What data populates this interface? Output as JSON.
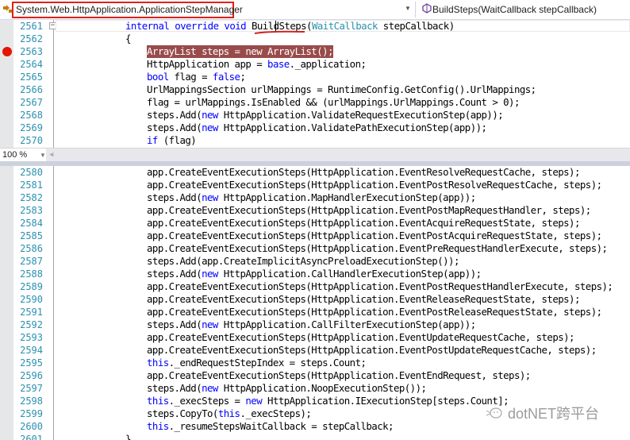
{
  "navbar": {
    "class_icon": "class-icon",
    "class_name": "System.Web.HttpApplication.ApplicationStepManager",
    "method_icon": "method-icon",
    "method_name": "BuildSteps(WaitCallback stepCallback)"
  },
  "editor": {
    "zoom_level": "100 %",
    "breakpoint_line": 2563,
    "top_pane": [
      {
        "n": "2561",
        "indent": 11,
        "tokens": [
          [
            "kw",
            "internal"
          ],
          [
            "t",
            " "
          ],
          [
            "kw",
            "override"
          ],
          [
            "t",
            " "
          ],
          [
            "kw",
            "void"
          ],
          [
            "t",
            " BuildSteps("
          ],
          [
            "ty",
            "WaitCallback"
          ],
          [
            "t",
            " stepCallback)"
          ]
        ]
      },
      {
        "n": "2562",
        "indent": 11,
        "tokens": [
          [
            "t",
            "{"
          ]
        ]
      },
      {
        "n": "2563",
        "indent": 15,
        "tokens": [
          [
            "t",
            "ArrayList steps = new ArrayList();"
          ]
        ]
      },
      {
        "n": "2564",
        "indent": 15,
        "tokens": [
          [
            "t",
            "HttpApplication app = "
          ],
          [
            "kw",
            "base"
          ],
          [
            "t",
            "._application;"
          ]
        ]
      },
      {
        "n": "2565",
        "indent": 15,
        "tokens": [
          [
            "kw",
            "bool"
          ],
          [
            "t",
            " flag = "
          ],
          [
            "kw",
            "false"
          ],
          [
            "t",
            ";"
          ]
        ]
      },
      {
        "n": "2566",
        "indent": 15,
        "tokens": [
          [
            "t",
            "UrlMappingsSection urlMappings = RuntimeConfig.GetConfig().UrlMappings;"
          ]
        ]
      },
      {
        "n": "2567",
        "indent": 15,
        "tokens": [
          [
            "t",
            "flag = urlMappings.IsEnabled && (urlMappings.UrlMappings.Count > 0);"
          ]
        ]
      },
      {
        "n": "2568",
        "indent": 15,
        "tokens": [
          [
            "t",
            "steps.Add("
          ],
          [
            "kw",
            "new"
          ],
          [
            "t",
            " HttpApplication.ValidateRequestExecutionStep(app));"
          ]
        ]
      },
      {
        "n": "2569",
        "indent": 15,
        "tokens": [
          [
            "t",
            "steps.Add("
          ],
          [
            "kw",
            "new"
          ],
          [
            "t",
            " HttpApplication.ValidatePathExecutionStep(app));"
          ]
        ]
      },
      {
        "n": "2570",
        "indent": 15,
        "tokens": [
          [
            "kw",
            "if"
          ],
          [
            "t",
            " (flag)"
          ]
        ]
      },
      {
        "n": "",
        "indent": 15,
        "tokens": [
          [
            "t",
            "{"
          ]
        ]
      }
    ],
    "bottom_pane": [
      {
        "n": "2580",
        "indent": 15,
        "tokens": [
          [
            "t",
            "app.CreateEventExecutionSteps(HttpApplication.EventResolveRequestCache, steps);"
          ]
        ]
      },
      {
        "n": "2581",
        "indent": 15,
        "tokens": [
          [
            "t",
            "app.CreateEventExecutionSteps(HttpApplication.EventPostResolveRequestCache, steps);"
          ]
        ]
      },
      {
        "n": "2582",
        "indent": 15,
        "tokens": [
          [
            "t",
            "steps.Add("
          ],
          [
            "kw",
            "new"
          ],
          [
            "t",
            " HttpApplication.MapHandlerExecutionStep(app));"
          ]
        ]
      },
      {
        "n": "2583",
        "indent": 15,
        "tokens": [
          [
            "t",
            "app.CreateEventExecutionSteps(HttpApplication.EventPostMapRequestHandler, steps);"
          ]
        ]
      },
      {
        "n": "2584",
        "indent": 15,
        "tokens": [
          [
            "t",
            "app.CreateEventExecutionSteps(HttpApplication.EventAcquireRequestState, steps);"
          ]
        ]
      },
      {
        "n": "2585",
        "indent": 15,
        "tokens": [
          [
            "t",
            "app.CreateEventExecutionSteps(HttpApplication.EventPostAcquireRequestState, steps);"
          ]
        ]
      },
      {
        "n": "2586",
        "indent": 15,
        "tokens": [
          [
            "t",
            "app.CreateEventExecutionSteps(HttpApplication.EventPreRequestHandlerExecute, steps);"
          ]
        ]
      },
      {
        "n": "2587",
        "indent": 15,
        "tokens": [
          [
            "t",
            "steps.Add(app.CreateImplicitAsyncPreloadExecutionStep());"
          ]
        ]
      },
      {
        "n": "2588",
        "indent": 15,
        "tokens": [
          [
            "t",
            "steps.Add("
          ],
          [
            "kw",
            "new"
          ],
          [
            "t",
            " HttpApplication.CallHandlerExecutionStep(app));"
          ]
        ]
      },
      {
        "n": "2589",
        "indent": 15,
        "tokens": [
          [
            "t",
            "app.CreateEventExecutionSteps(HttpApplication.EventPostRequestHandlerExecute, steps);"
          ]
        ]
      },
      {
        "n": "2590",
        "indent": 15,
        "tokens": [
          [
            "t",
            "app.CreateEventExecutionSteps(HttpApplication.EventReleaseRequestState, steps);"
          ]
        ]
      },
      {
        "n": "2591",
        "indent": 15,
        "tokens": [
          [
            "t",
            "app.CreateEventExecutionSteps(HttpApplication.EventPostReleaseRequestState, steps);"
          ]
        ]
      },
      {
        "n": "2592",
        "indent": 15,
        "tokens": [
          [
            "t",
            "steps.Add("
          ],
          [
            "kw",
            "new"
          ],
          [
            "t",
            " HttpApplication.CallFilterExecutionStep(app));"
          ]
        ]
      },
      {
        "n": "2593",
        "indent": 15,
        "tokens": [
          [
            "t",
            "app.CreateEventExecutionSteps(HttpApplication.EventUpdateRequestCache, steps);"
          ]
        ]
      },
      {
        "n": "2594",
        "indent": 15,
        "tokens": [
          [
            "t",
            "app.CreateEventExecutionSteps(HttpApplication.EventPostUpdateRequestCache, steps);"
          ]
        ]
      },
      {
        "n": "2595",
        "indent": 15,
        "tokens": [
          [
            "kw",
            "this"
          ],
          [
            "t",
            "._endRequestStepIndex = steps.Count;"
          ]
        ]
      },
      {
        "n": "2596",
        "indent": 15,
        "tokens": [
          [
            "t",
            "app.CreateEventExecutionSteps(HttpApplication.EventEndRequest, steps);"
          ]
        ]
      },
      {
        "n": "2597",
        "indent": 15,
        "tokens": [
          [
            "t",
            "steps.Add("
          ],
          [
            "kw",
            "new"
          ],
          [
            "t",
            " HttpApplication.NoopExecutionStep());"
          ]
        ]
      },
      {
        "n": "2598",
        "indent": 15,
        "tokens": [
          [
            "kw",
            "this"
          ],
          [
            "t",
            "._execSteps = "
          ],
          [
            "kw",
            "new"
          ],
          [
            "t",
            " HttpApplication.IExecutionStep[steps.Count];"
          ]
        ]
      },
      {
        "n": "2599",
        "indent": 15,
        "tokens": [
          [
            "t",
            "steps.CopyTo("
          ],
          [
            "kw",
            "this"
          ],
          [
            "t",
            "._execSteps);"
          ]
        ]
      },
      {
        "n": "2600",
        "indent": 15,
        "tokens": [
          [
            "kw",
            "this"
          ],
          [
            "t",
            "._resumeStepsWaitCallback = stepCallback;"
          ]
        ]
      },
      {
        "n": "2601",
        "indent": 11,
        "tokens": [
          [
            "t",
            "}"
          ]
        ]
      }
    ]
  },
  "watermark": {
    "icon": "wechat-icon",
    "text": "dotNET跨平台"
  },
  "colors": {
    "keyword": "#0000ff",
    "type": "#2b91af",
    "line_number": "#2b91af",
    "breakpoint": "#e51400",
    "breakpoint_line_bg": "#994b4b",
    "highlight_box": "#e0201a"
  }
}
